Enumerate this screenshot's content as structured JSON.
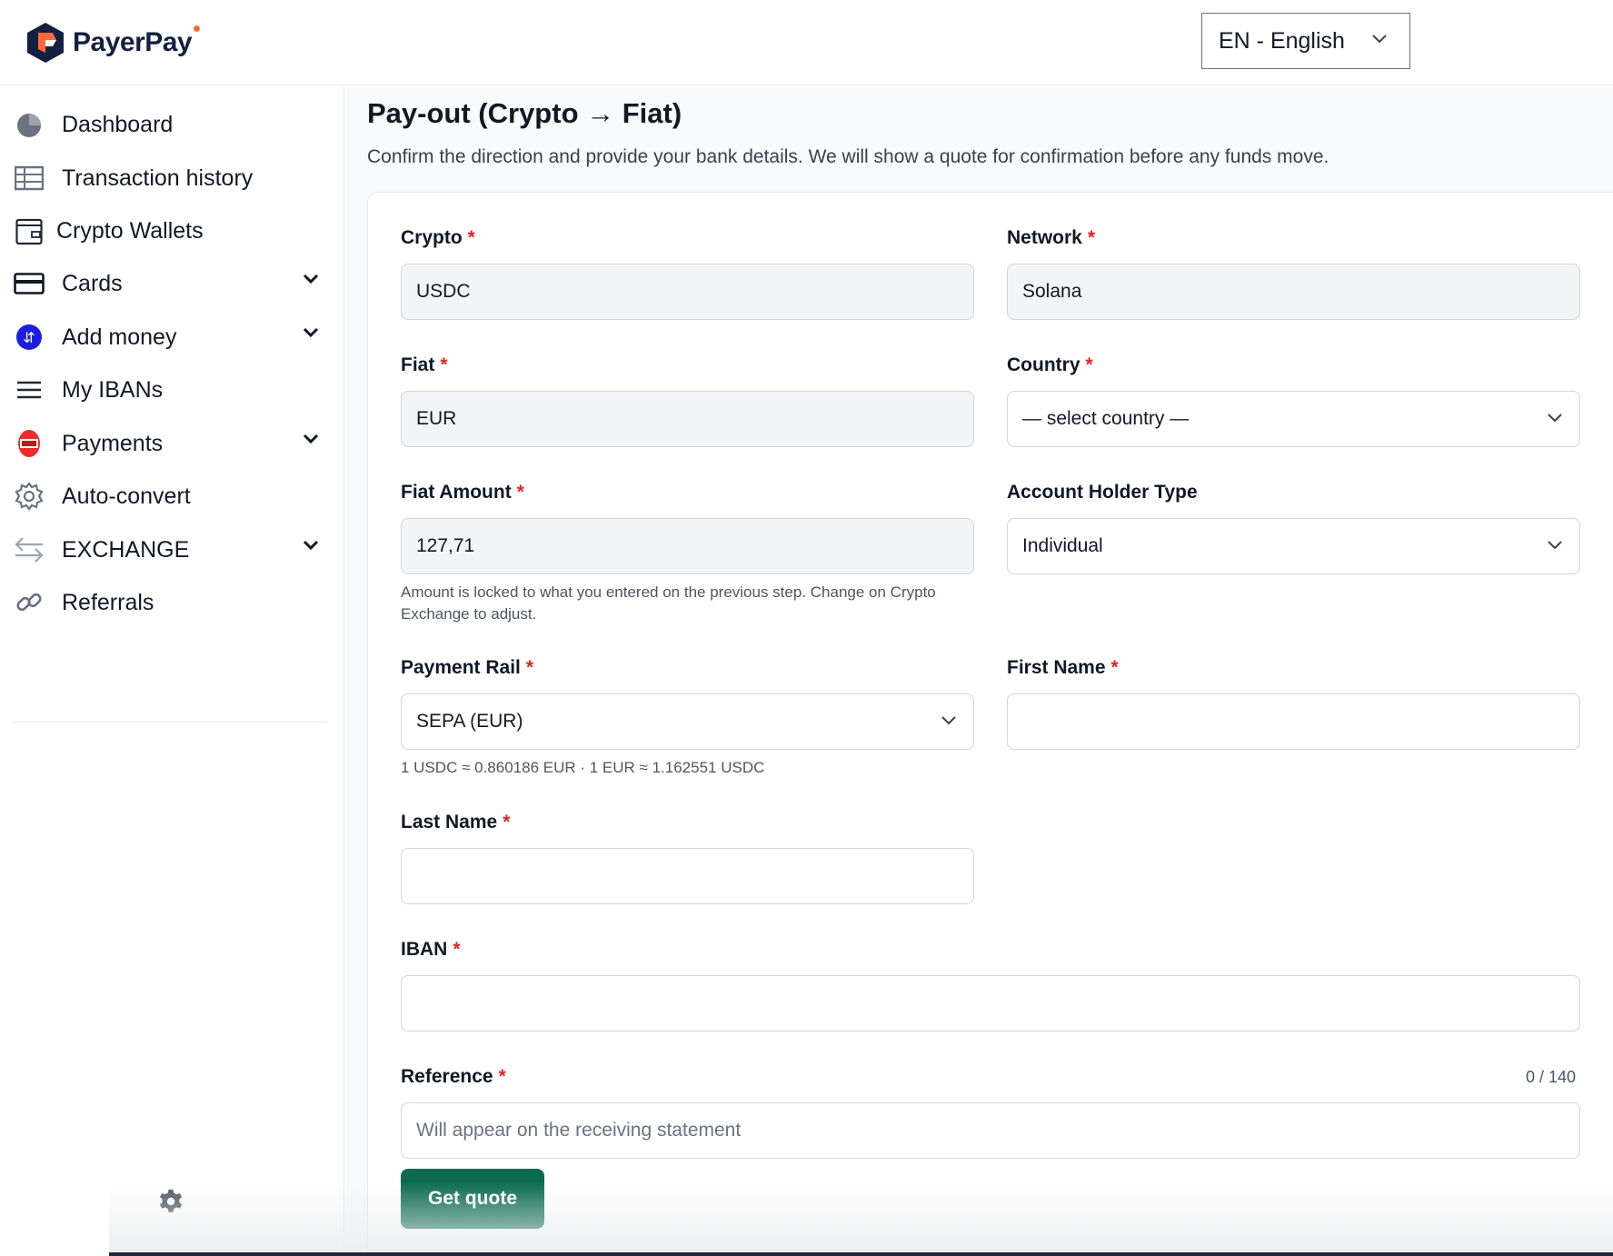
{
  "brand": {
    "name": "PayerPay",
    "accent": "#ff6a3d",
    "dark": "#13213f"
  },
  "header": {
    "language": "EN - English"
  },
  "sidebar": {
    "items": [
      {
        "label": "Dashboard",
        "icon": "pie-chart-icon"
      },
      {
        "label": "Transaction history",
        "icon": "table-icon"
      },
      {
        "label": "Crypto Wallets",
        "icon": "wallet-icon"
      },
      {
        "label": "Cards",
        "icon": "credit-card-icon",
        "expandable": true
      },
      {
        "label": "Add money",
        "icon": "add-money-icon",
        "expandable": true
      },
      {
        "label": "My IBANs",
        "icon": "menu-lines-icon"
      },
      {
        "label": "Payments",
        "icon": "payments-icon",
        "expandable": true
      },
      {
        "label": "Auto-convert",
        "icon": "gear-icon"
      },
      {
        "label": "EXCHANGE",
        "icon": "exchange-arrows-icon",
        "expandable": true
      },
      {
        "label": "Referrals",
        "icon": "link-icon"
      }
    ]
  },
  "main": {
    "title": "Pay-out (Crypto → Fiat)",
    "subtitle": "Confirm the direction and provide your bank details. We will show a quote for confirmation before any funds move."
  },
  "form": {
    "crypto": {
      "label": "Crypto",
      "value": "USDC"
    },
    "network": {
      "label": "Network",
      "value": "Solana"
    },
    "fiat": {
      "label": "Fiat",
      "value": "EUR"
    },
    "country": {
      "label": "Country",
      "value": "— select country —"
    },
    "fiat_amount": {
      "label": "Fiat Amount",
      "value": "127,71",
      "hint": "Amount is locked to what you entered on the previous step. Change on Crypto Exchange to adjust."
    },
    "account_holder_type": {
      "label": "Account Holder Type",
      "value": "Individual"
    },
    "payment_rail": {
      "label": "Payment Rail",
      "value": "SEPA (EUR)",
      "rate": "1 USDC ≈ 0.860186 EUR · 1 EUR ≈ 1.162551 USDC"
    },
    "first_name": {
      "label": "First Name",
      "value": ""
    },
    "last_name": {
      "label": "Last Name",
      "value": ""
    },
    "iban": {
      "label": "IBAN",
      "value": ""
    },
    "reference": {
      "label": "Reference",
      "placeholder": "Will appear on the receiving statement",
      "counter": "0 / 140"
    },
    "required_mark": "*",
    "submit_label": "Get quote"
  },
  "colors": {
    "primary_button": "#0b6b4f",
    "required": "#dc2626"
  }
}
